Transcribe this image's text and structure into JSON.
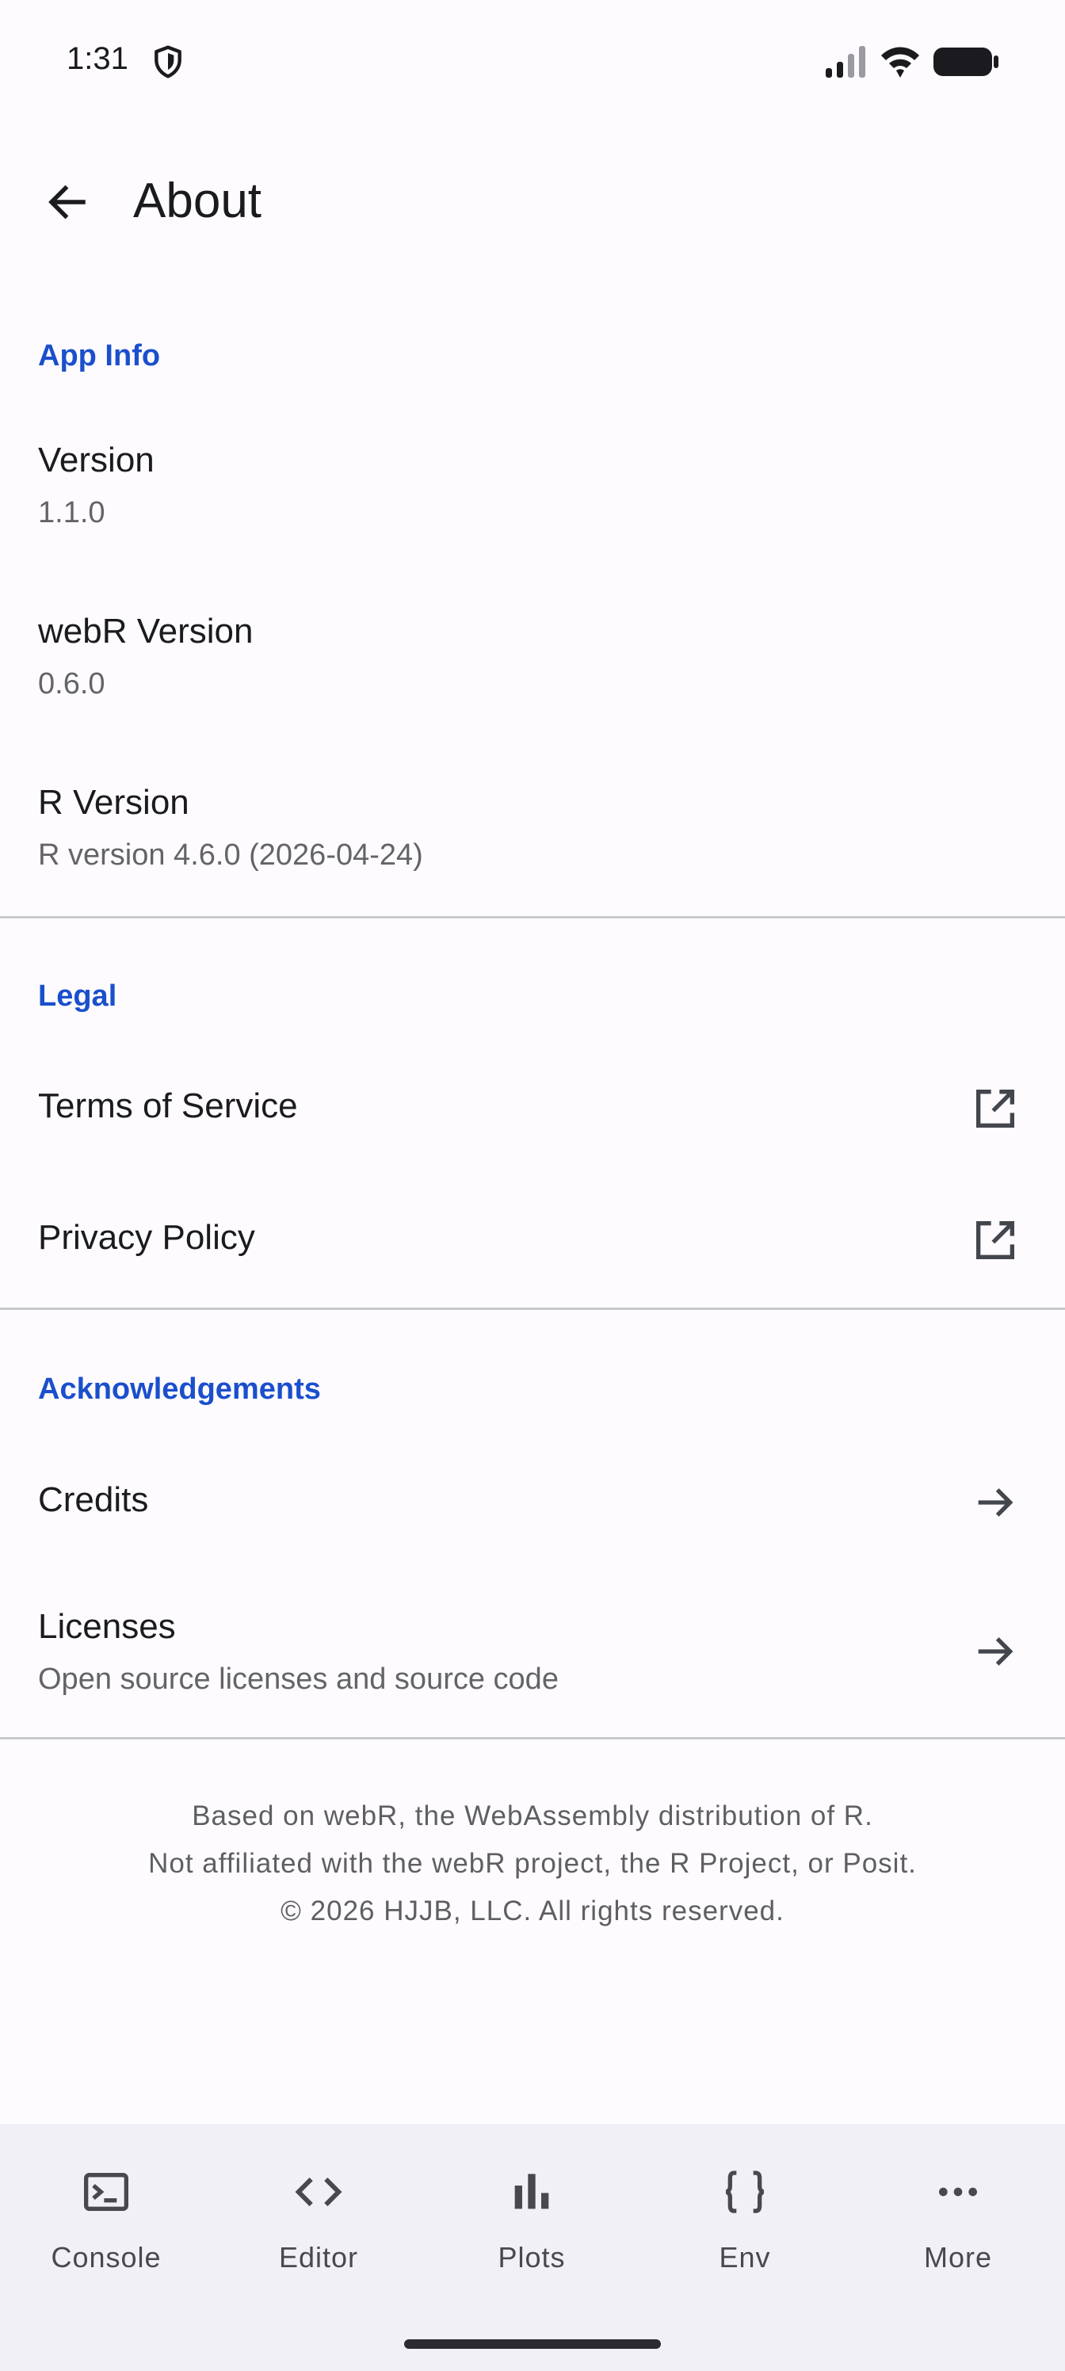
{
  "status_bar": {
    "time": "1:31"
  },
  "app_bar": {
    "title": "About"
  },
  "app_info": {
    "header": "App Info",
    "items": [
      {
        "title": "Version",
        "value": "1.1.0"
      },
      {
        "title": "webR Version",
        "value": "0.6.0"
      },
      {
        "title": "R Version",
        "value": "R version 4.6.0 (2026-04-24)"
      }
    ]
  },
  "legal": {
    "header": "Legal",
    "items": [
      {
        "label": "Terms of Service",
        "icon": "open-in-new-icon"
      },
      {
        "label": "Privacy Policy",
        "icon": "open-in-new-icon"
      }
    ]
  },
  "acknowledgements": {
    "header": "Acknowledgements",
    "items": [
      {
        "label": "Credits",
        "icon": "arrow-right-icon"
      },
      {
        "label": "Licenses",
        "subtitle": "Open source licenses and source code",
        "icon": "arrow-right-icon"
      }
    ]
  },
  "footer": {
    "lines": [
      "Based on webR, the WebAssembly distribution of R.",
      "Not affiliated with the webR project, the R Project, or Posit.",
      "© 2026 HJJB, LLC. All rights reserved."
    ]
  },
  "bottom_nav": {
    "items": [
      {
        "label": "Console",
        "icon": "terminal-icon"
      },
      {
        "label": "Editor",
        "icon": "code-icon"
      },
      {
        "label": "Plots",
        "icon": "bar-chart-icon"
      },
      {
        "label": "Env",
        "icon": "braces-icon"
      },
      {
        "label": "More",
        "icon": "more-horizontal-icon"
      }
    ]
  },
  "colors": {
    "accent": "#1a4fcc",
    "background": "#fefbff",
    "nav_background": "#f1f0f6",
    "divider": "#c8c8cf"
  }
}
